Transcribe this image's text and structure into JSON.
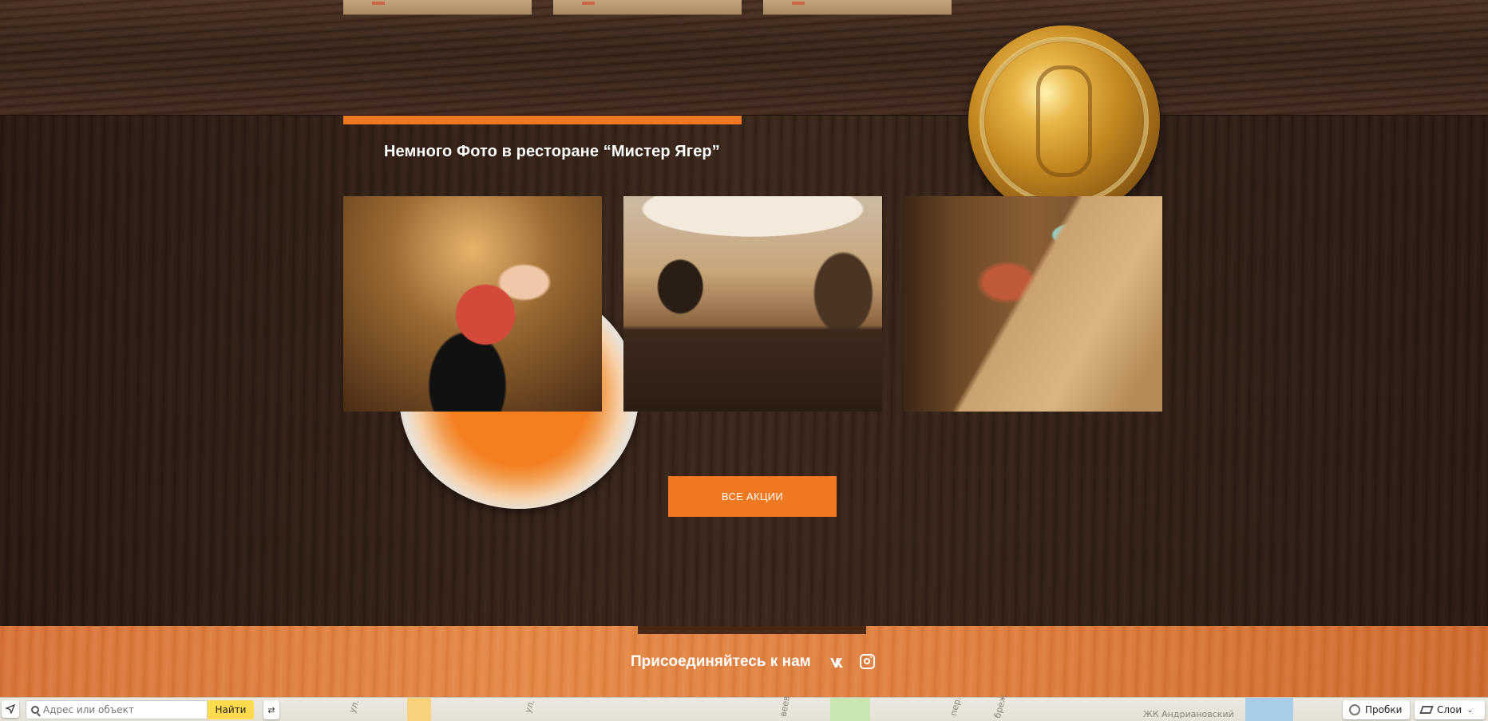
{
  "gallery": {
    "title": "Немного Фото в ресторане “Мистер Ягер”",
    "photos": [
      {
        "alt": ""
      },
      {
        "alt": ""
      },
      {
        "alt": ""
      }
    ]
  },
  "buttons": {
    "all_promos": "ВСЕ АКЦИИ"
  },
  "footer": {
    "join_text": "Присоединяйтесь к нам",
    "social": {
      "vk": "vk-icon",
      "instagram": "instagram-icon",
      "vk_label": "ВК"
    }
  },
  "map": {
    "search_placeholder": "Адрес или объект",
    "find_label": "Найти",
    "traffic_label": "Пробки",
    "layers_label": "Слои",
    "streets": [
      "ул.",
      "ул.",
      "ул.",
      "веев",
      "пер.",
      "бреж",
      "ЖК Андриановский"
    ]
  },
  "colors": {
    "accent": "#f07821",
    "dark_wood": "#3b271b",
    "footer_wood": "#e58947"
  }
}
